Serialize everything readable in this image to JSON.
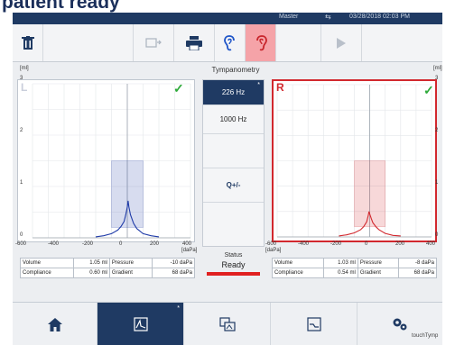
{
  "banner": {
    "text": "patient ready"
  },
  "status_bar": {
    "mode": "Master",
    "datetime": "03/28/2018 02:03 PM"
  },
  "toolbar": {
    "icons": [
      "trash-icon",
      "export-icon",
      "printer-icon",
      "left-ear-icon",
      "right-ear-icon",
      "play-icon"
    ],
    "highlight_color": "#f5a3a8"
  },
  "center": {
    "title": "Tympanometry",
    "freq_active": "226 Hz",
    "freq_marker": "*",
    "freq_alt": "1000 Hz",
    "zoom_label": "Q+/-",
    "status_label": "Status",
    "status_value": "Ready",
    "status_color": "#e02020"
  },
  "left_ear": {
    "tag": "L",
    "color": "#1f3ba8",
    "chart_data": {
      "type": "line",
      "xlabel": "[daPa]",
      "ylabel": "[ml]",
      "xticks": [
        "-600",
        "-400",
        "-200",
        "0",
        "200",
        "400"
      ],
      "yticks": [
        "3",
        "2",
        "1",
        "0"
      ],
      "xlim": [
        -600,
        400
      ],
      "ylim": [
        0,
        3
      ],
      "normal_region": {
        "x": [
          -100,
          100
        ],
        "y": [
          0.2,
          1.5
        ]
      },
      "series": [
        {
          "x": [
            -200,
            -150,
            -100,
            -60,
            -40,
            -20,
            -10,
            0,
            5,
            10,
            20,
            40,
            60,
            100,
            150,
            200
          ],
          "y": [
            0.02,
            0.04,
            0.08,
            0.15,
            0.22,
            0.32,
            0.45,
            0.6,
            0.72,
            0.6,
            0.45,
            0.28,
            0.18,
            0.08,
            0.04,
            0.02
          ]
        }
      ]
    },
    "measurements": {
      "volume_label": "Volume",
      "volume_value": "1.05 ml",
      "pressure_label": "Pressure",
      "pressure_value": "-10 daPa",
      "compliance_label": "Compliance",
      "compliance_value": "0.60 ml",
      "gradient_label": "Gradient",
      "gradient_value": "68 daPa"
    }
  },
  "right_ear": {
    "tag": "R",
    "color": "#d2282e",
    "chart_data": {
      "type": "line",
      "xlabel": "[daPa]",
      "ylabel": "[ml]",
      "xticks": [
        "-600",
        "-400",
        "-200",
        "0",
        "200",
        "400"
      ],
      "yticks": [
        "3",
        "2",
        "1",
        "0"
      ],
      "xlim": [
        -600,
        400
      ],
      "ylim": [
        0,
        3
      ],
      "normal_region": {
        "x": [
          -100,
          100
        ],
        "y": [
          0.2,
          1.5
        ]
      },
      "series": [
        {
          "x": [
            -200,
            -150,
            -100,
            -60,
            -40,
            -20,
            -10,
            -5,
            0,
            10,
            20,
            40,
            60,
            100,
            150,
            200
          ],
          "y": [
            0.02,
            0.04,
            0.08,
            0.14,
            0.2,
            0.3,
            0.42,
            0.5,
            0.45,
            0.36,
            0.28,
            0.2,
            0.14,
            0.07,
            0.03,
            0.02
          ]
        }
      ]
    },
    "measurements": {
      "volume_label": "Volume",
      "volume_value": "1.03 ml",
      "pressure_label": "Pressure",
      "pressure_value": "-8 daPa",
      "compliance_label": "Compliance",
      "compliance_value": "0.54 ml",
      "gradient_label": "Gradient",
      "gradient_value": "68 daPa"
    }
  },
  "bottom_nav": {
    "items": [
      "home-icon",
      "tympanometry-icon",
      "compare-icon",
      "curve-icon",
      "settings-icon"
    ],
    "active_marker": "*",
    "brand": "touchTymp"
  },
  "check_color": "#2eaa3a"
}
